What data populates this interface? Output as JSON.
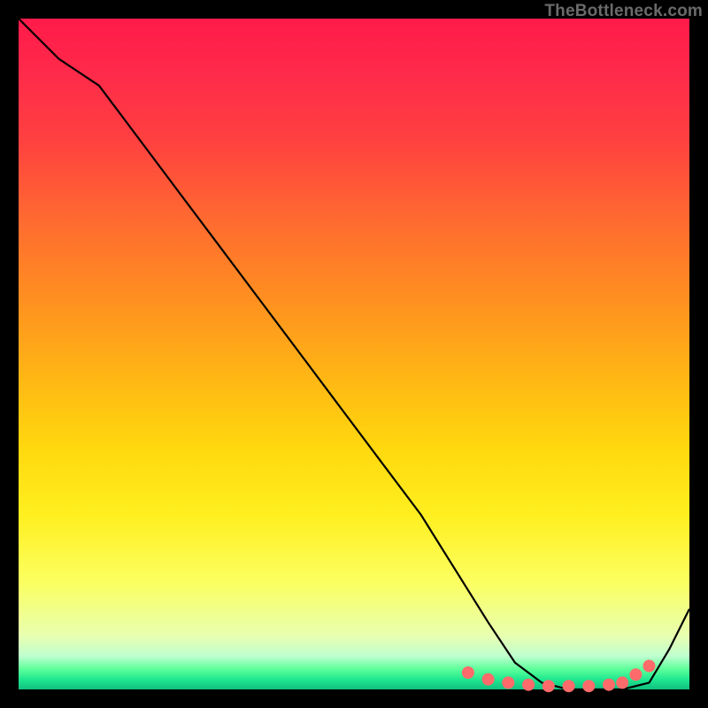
{
  "watermark": {
    "text": "TheBottleneck.com"
  },
  "colors": {
    "curve_stroke": "#000000",
    "dot_fill": "#ff6b6b",
    "dot_stroke": "#ff6b6b"
  },
  "chart_data": {
    "type": "line",
    "title": "",
    "xlabel": "",
    "ylabel": "",
    "xlim": [
      0,
      100
    ],
    "ylim": [
      0,
      100
    ],
    "series": [
      {
        "name": "bottleneck-curve",
        "x": [
          0,
          6,
          12,
          18,
          24,
          30,
          36,
          42,
          48,
          54,
          60,
          65,
          70,
          74,
          78,
          82,
          86,
          90,
          94,
          97,
          100
        ],
        "y": [
          100,
          94,
          90,
          82,
          74,
          66,
          58,
          50,
          42,
          34,
          26,
          18,
          10,
          4,
          1,
          0,
          0,
          0,
          1,
          6,
          12
        ]
      }
    ],
    "highlight_dots": {
      "series": "bottleneck-curve",
      "x": [
        67,
        70,
        73,
        76,
        79,
        82,
        85,
        88,
        90,
        92,
        94
      ],
      "y": [
        2.5,
        1.5,
        1.0,
        0.7,
        0.5,
        0.5,
        0.5,
        0.7,
        1.0,
        2.2,
        3.5
      ]
    }
  }
}
